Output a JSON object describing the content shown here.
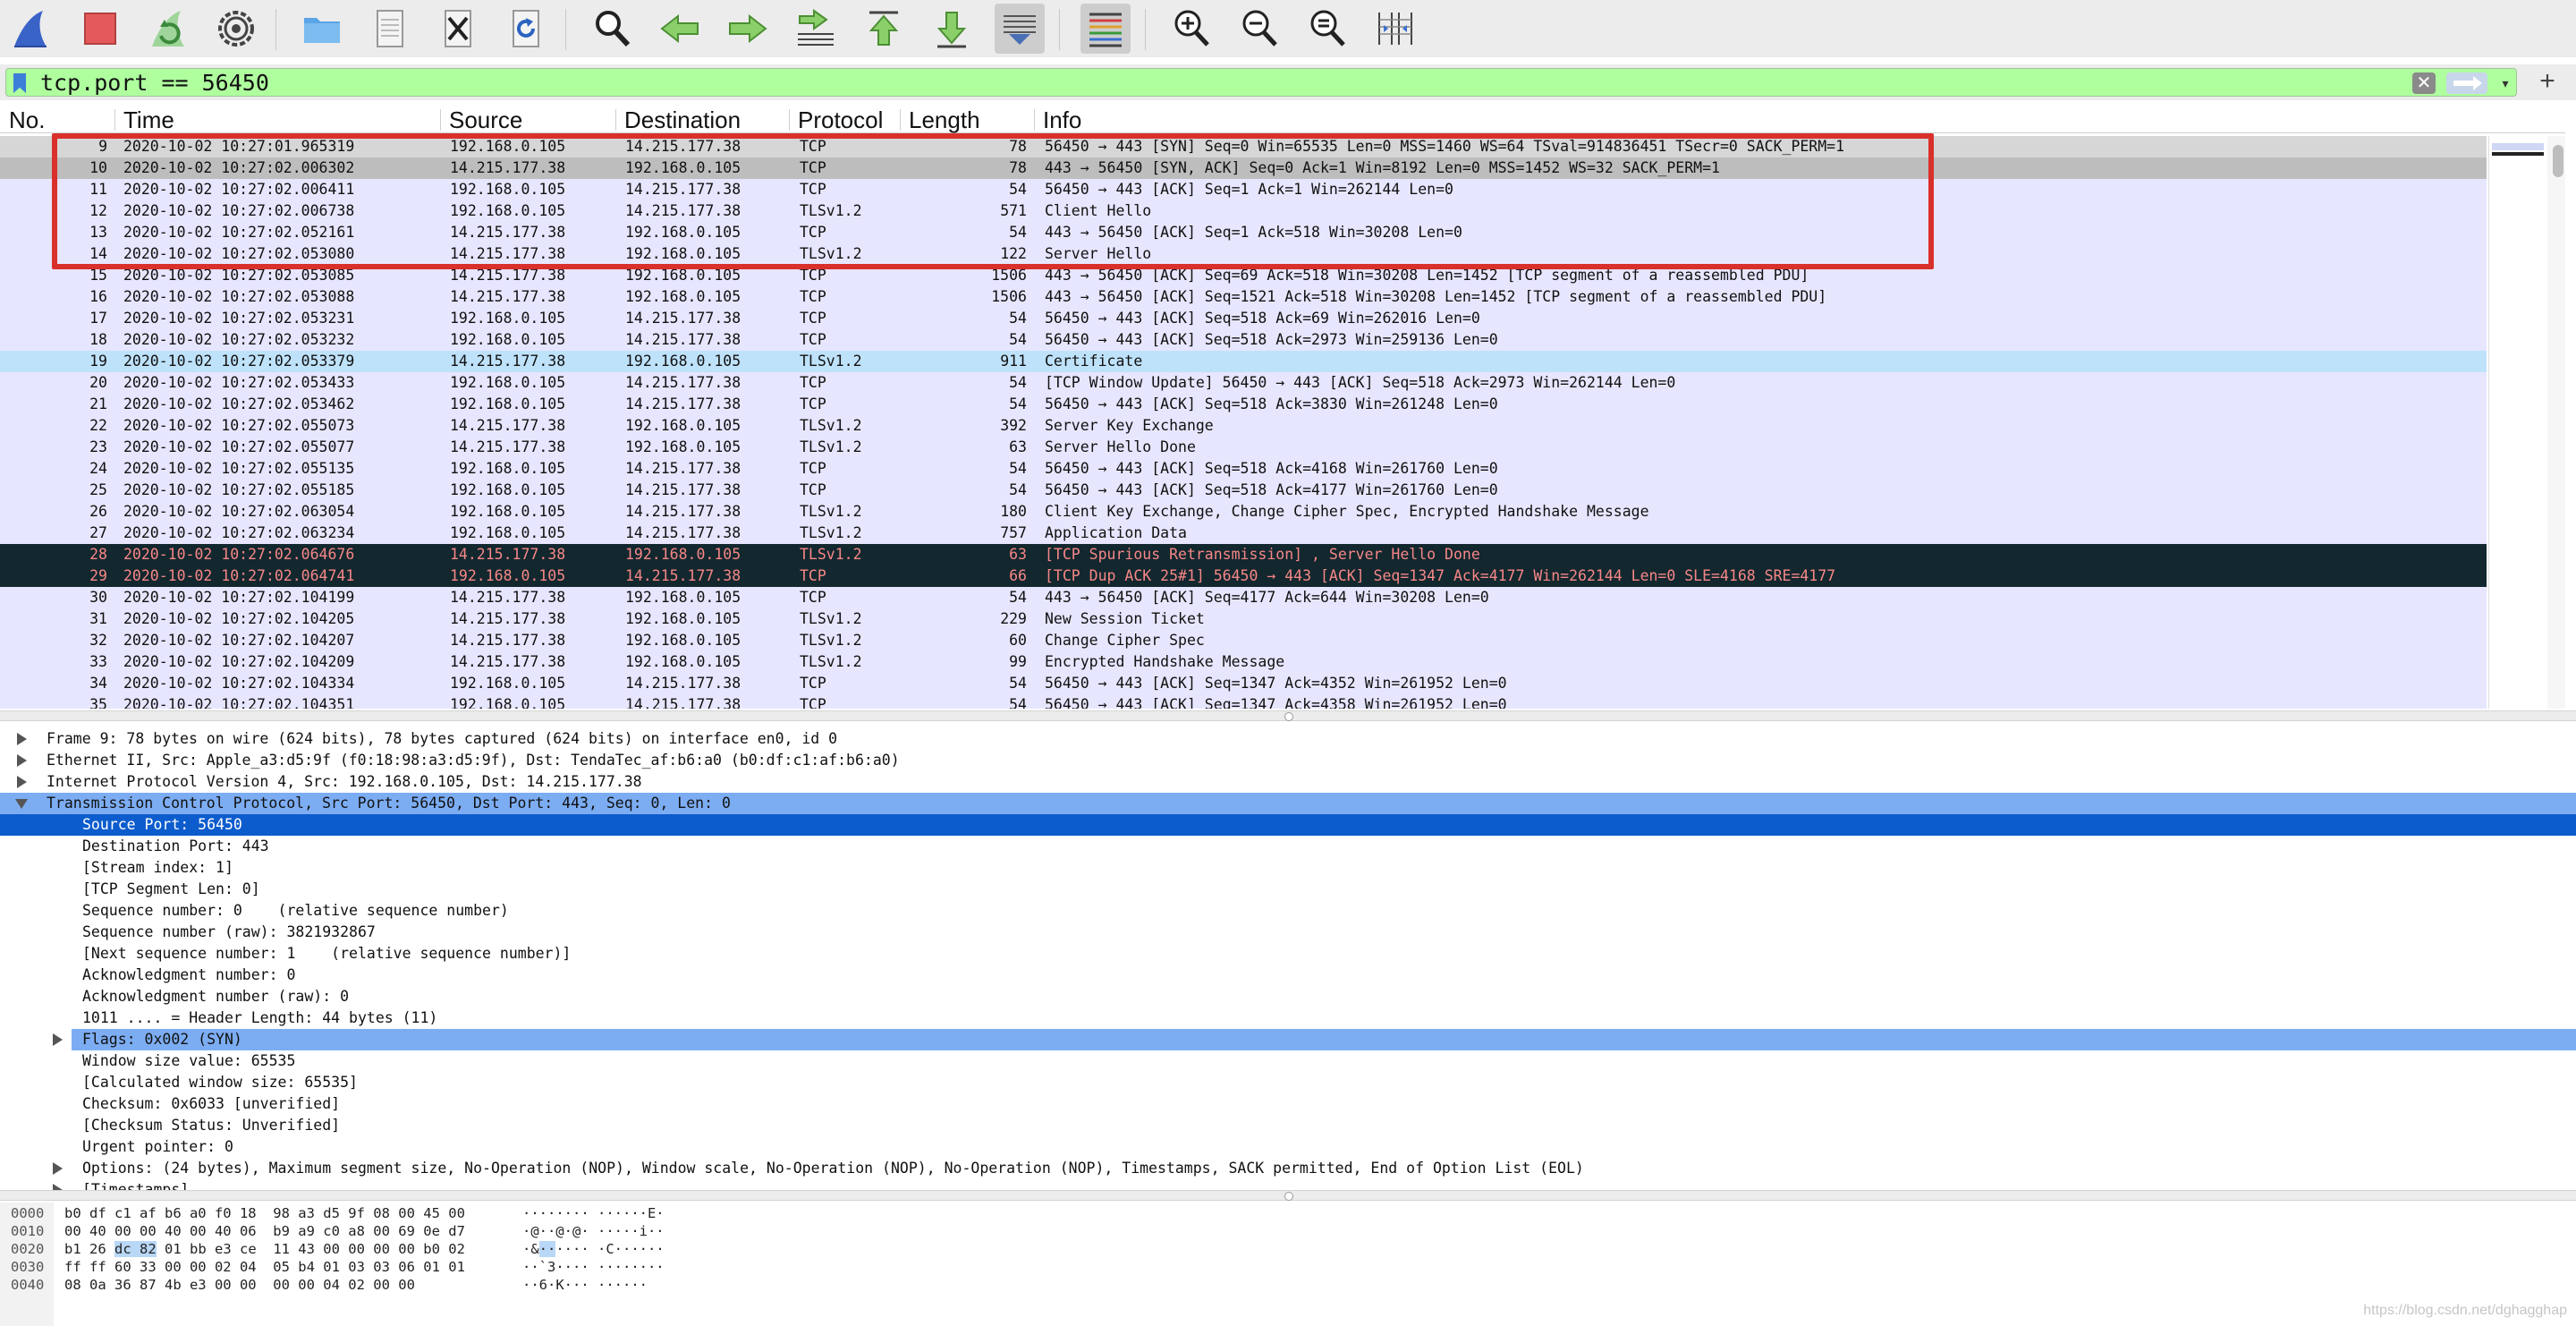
{
  "colors": {
    "row_tcp": "#e7e6ff",
    "row_selected": "#bdbdbd",
    "row_first": "#d6d6d6",
    "row_highlight": "#bfe2fb",
    "row_error_bg": "#12272e",
    "row_error_fg": "#f78787",
    "filter_bg": "#afff9f",
    "detail_selected": "#0d5ccd",
    "detail_header_selected": "#7cadf3",
    "annotation": "#d9302b"
  },
  "toolbar": {
    "icons": [
      "shark-fin-start-icon",
      "stop-capture-icon",
      "restart-capture-icon",
      "capture-options-gear-icon",
      "open-file-folder-icon",
      "file-document-icon",
      "close-file-icon",
      "reload-file-icon",
      "find-packet-magnifier-icon",
      "go-back-arrow-icon",
      "go-forward-arrow-icon",
      "go-to-packet-icon",
      "go-to-first-packet-icon",
      "go-to-last-packet-icon",
      "auto-scroll-icon",
      "colorize-icon",
      "zoom-in-icon",
      "zoom-out-icon",
      "normal-size-icon",
      "resize-columns-icon"
    ]
  },
  "filter": {
    "value": "tcp.port == 56450",
    "clear_glyph": "✕",
    "dropdown_glyph": "▾",
    "add_glyph": "+"
  },
  "columns": {
    "no": "No.",
    "time": "Time",
    "source": "Source",
    "destination": "Destination",
    "protocol": "Protocol",
    "length": "Length",
    "info": "Info"
  },
  "packets": [
    {
      "no": "9",
      "time": "2020-10-02 10:27:01.965319",
      "src": "192.168.0.105",
      "dst": "14.215.177.38",
      "proto": "TCP",
      "len": "78",
      "info": "56450 → 443 [SYN] Seq=0 Win=65535 Len=0 MSS=1460 WS=64 TSval=914836451 TSecr=0 SACK_PERM=1",
      "style": "first"
    },
    {
      "no": "10",
      "time": "2020-10-02 10:27:02.006302",
      "src": "14.215.177.38",
      "dst": "192.168.0.105",
      "proto": "TCP",
      "len": "78",
      "info": "443 → 56450 [SYN, ACK] Seq=0 Ack=1 Win=8192 Len=0 MSS=1452 WS=32 SACK_PERM=1",
      "style": "selected"
    },
    {
      "no": "11",
      "time": "2020-10-02 10:27:02.006411",
      "src": "192.168.0.105",
      "dst": "14.215.177.38",
      "proto": "TCP",
      "len": "54",
      "info": "56450 → 443 [ACK] Seq=1 Ack=1 Win=262144 Len=0",
      "style": "tcp"
    },
    {
      "no": "12",
      "time": "2020-10-02 10:27:02.006738",
      "src": "192.168.0.105",
      "dst": "14.215.177.38",
      "proto": "TLSv1.2",
      "len": "571",
      "info": "Client Hello",
      "style": "tcp"
    },
    {
      "no": "13",
      "time": "2020-10-02 10:27:02.052161",
      "src": "14.215.177.38",
      "dst": "192.168.0.105",
      "proto": "TCP",
      "len": "54",
      "info": "443 → 56450 [ACK] Seq=1 Ack=518 Win=30208 Len=0",
      "style": "tcp"
    },
    {
      "no": "14",
      "time": "2020-10-02 10:27:02.053080",
      "src": "14.215.177.38",
      "dst": "192.168.0.105",
      "proto": "TLSv1.2",
      "len": "122",
      "info": "Server Hello",
      "style": "tcp"
    },
    {
      "no": "15",
      "time": "2020-10-02 10:27:02.053085",
      "src": "14.215.177.38",
      "dst": "192.168.0.105",
      "proto": "TCP",
      "len": "1506",
      "info": "443 → 56450 [ACK] Seq=69 Ack=518 Win=30208 Len=1452 [TCP segment of a reassembled PDU]",
      "style": "tcp"
    },
    {
      "no": "16",
      "time": "2020-10-02 10:27:02.053088",
      "src": "14.215.177.38",
      "dst": "192.168.0.105",
      "proto": "TCP",
      "len": "1506",
      "info": "443 → 56450 [ACK] Seq=1521 Ack=518 Win=30208 Len=1452 [TCP segment of a reassembled PDU]",
      "style": "tcp"
    },
    {
      "no": "17",
      "time": "2020-10-02 10:27:02.053231",
      "src": "192.168.0.105",
      "dst": "14.215.177.38",
      "proto": "TCP",
      "len": "54",
      "info": "56450 → 443 [ACK] Seq=518 Ack=69 Win=262016 Len=0",
      "style": "tcp"
    },
    {
      "no": "18",
      "time": "2020-10-02 10:27:02.053232",
      "src": "192.168.0.105",
      "dst": "14.215.177.38",
      "proto": "TCP",
      "len": "54",
      "info": "56450 → 443 [ACK] Seq=518 Ack=2973 Win=259136 Len=0",
      "style": "tcp"
    },
    {
      "no": "19",
      "time": "2020-10-02 10:27:02.053379",
      "src": "14.215.177.38",
      "dst": "192.168.0.105",
      "proto": "TLSv1.2",
      "len": "911",
      "info": "Certificate",
      "style": "highlight"
    },
    {
      "no": "20",
      "time": "2020-10-02 10:27:02.053433",
      "src": "192.168.0.105",
      "dst": "14.215.177.38",
      "proto": "TCP",
      "len": "54",
      "info": "[TCP Window Update] 56450 → 443 [ACK] Seq=518 Ack=2973 Win=262144 Len=0",
      "style": "tcp"
    },
    {
      "no": "21",
      "time": "2020-10-02 10:27:02.053462",
      "src": "192.168.0.105",
      "dst": "14.215.177.38",
      "proto": "TCP",
      "len": "54",
      "info": "56450 → 443 [ACK] Seq=518 Ack=3830 Win=261248 Len=0",
      "style": "tcp"
    },
    {
      "no": "22",
      "time": "2020-10-02 10:27:02.055073",
      "src": "14.215.177.38",
      "dst": "192.168.0.105",
      "proto": "TLSv1.2",
      "len": "392",
      "info": "Server Key Exchange",
      "style": "tcp"
    },
    {
      "no": "23",
      "time": "2020-10-02 10:27:02.055077",
      "src": "14.215.177.38",
      "dst": "192.168.0.105",
      "proto": "TLSv1.2",
      "len": "63",
      "info": "Server Hello Done",
      "style": "tcp"
    },
    {
      "no": "24",
      "time": "2020-10-02 10:27:02.055135",
      "src": "192.168.0.105",
      "dst": "14.215.177.38",
      "proto": "TCP",
      "len": "54",
      "info": "56450 → 443 [ACK] Seq=518 Ack=4168 Win=261760 Len=0",
      "style": "tcp"
    },
    {
      "no": "25",
      "time": "2020-10-02 10:27:02.055185",
      "src": "192.168.0.105",
      "dst": "14.215.177.38",
      "proto": "TCP",
      "len": "54",
      "info": "56450 → 443 [ACK] Seq=518 Ack=4177 Win=261760 Len=0",
      "style": "tcp"
    },
    {
      "no": "26",
      "time": "2020-10-02 10:27:02.063054",
      "src": "192.168.0.105",
      "dst": "14.215.177.38",
      "proto": "TLSv1.2",
      "len": "180",
      "info": "Client Key Exchange, Change Cipher Spec, Encrypted Handshake Message",
      "style": "tcp"
    },
    {
      "no": "27",
      "time": "2020-10-02 10:27:02.063234",
      "src": "192.168.0.105",
      "dst": "14.215.177.38",
      "proto": "TLSv1.2",
      "len": "757",
      "info": "Application Data",
      "style": "tcp"
    },
    {
      "no": "28",
      "time": "2020-10-02 10:27:02.064676",
      "src": "14.215.177.38",
      "dst": "192.168.0.105",
      "proto": "TLSv1.2",
      "len": "63",
      "info": "[TCP Spurious Retransmission] , Server Hello Done",
      "style": "error"
    },
    {
      "no": "29",
      "time": "2020-10-02 10:27:02.064741",
      "src": "192.168.0.105",
      "dst": "14.215.177.38",
      "proto": "TCP",
      "len": "66",
      "info": "[TCP Dup ACK 25#1] 56450 → 443 [ACK] Seq=1347 Ack=4177 Win=262144 Len=0 SLE=4168 SRE=4177",
      "style": "error"
    },
    {
      "no": "30",
      "time": "2020-10-02 10:27:02.104199",
      "src": "14.215.177.38",
      "dst": "192.168.0.105",
      "proto": "TCP",
      "len": "54",
      "info": "443 → 56450 [ACK] Seq=4177 Ack=644 Win=30208 Len=0",
      "style": "tcp"
    },
    {
      "no": "31",
      "time": "2020-10-02 10:27:02.104205",
      "src": "14.215.177.38",
      "dst": "192.168.0.105",
      "proto": "TLSv1.2",
      "len": "229",
      "info": "New Session Ticket",
      "style": "tcp"
    },
    {
      "no": "32",
      "time": "2020-10-02 10:27:02.104207",
      "src": "14.215.177.38",
      "dst": "192.168.0.105",
      "proto": "TLSv1.2",
      "len": "60",
      "info": "Change Cipher Spec",
      "style": "tcp"
    },
    {
      "no": "33",
      "time": "2020-10-02 10:27:02.104209",
      "src": "14.215.177.38",
      "dst": "192.168.0.105",
      "proto": "TLSv1.2",
      "len": "99",
      "info": "Encrypted Handshake Message",
      "style": "tcp"
    },
    {
      "no": "34",
      "time": "2020-10-02 10:27:02.104334",
      "src": "192.168.0.105",
      "dst": "14.215.177.38",
      "proto": "TCP",
      "len": "54",
      "info": "56450 → 443 [ACK] Seq=1347 Ack=4352 Win=261952 Len=0",
      "style": "tcp"
    },
    {
      "no": "35",
      "time": "2020-10-02 10:27:02.104351",
      "src": "192.168.0.105",
      "dst": "14.215.177.38",
      "proto": "TCP",
      "len": "54",
      "info": "56450 → 443 [ACK] Seq=1347 Ack=4358 Win=261952 Len=0",
      "style": "tcp"
    }
  ],
  "details": [
    {
      "text": "Frame 9: 78 bytes on wire (624 bits), 78 bytes captured (624 bits) on interface en0, id 0",
      "level": 0,
      "toggle": "collapsed",
      "style": ""
    },
    {
      "text": "Ethernet II, Src: Apple_a3:d5:9f (f0:18:98:a3:d5:9f), Dst: TendaTec_af:b6:a0 (b0:df:c1:af:b6:a0)",
      "level": 0,
      "toggle": "collapsed",
      "style": ""
    },
    {
      "text": "Internet Protocol Version 4, Src: 192.168.0.105, Dst: 14.215.177.38",
      "level": 0,
      "toggle": "collapsed",
      "style": ""
    },
    {
      "text": "Transmission Control Protocol, Src Port: 56450, Dst Port: 443, Seq: 0, Len: 0",
      "level": 0,
      "toggle": "expanded",
      "style": "header-selected"
    },
    {
      "text": "Source Port: 56450",
      "level": 1,
      "toggle": "",
      "style": "selected"
    },
    {
      "text": "Destination Port: 443",
      "level": 1,
      "toggle": "",
      "style": ""
    },
    {
      "text": "[Stream index: 1]",
      "level": 1,
      "toggle": "",
      "style": ""
    },
    {
      "text": "[TCP Segment Len: 0]",
      "level": 1,
      "toggle": "",
      "style": ""
    },
    {
      "text": "Sequence number: 0    (relative sequence number)",
      "level": 1,
      "toggle": "",
      "style": ""
    },
    {
      "text": "Sequence number (raw): 3821932867",
      "level": 1,
      "toggle": "",
      "style": ""
    },
    {
      "text": "[Next sequence number: 1    (relative sequence number)]",
      "level": 1,
      "toggle": "",
      "style": ""
    },
    {
      "text": "Acknowledgment number: 0",
      "level": 1,
      "toggle": "",
      "style": ""
    },
    {
      "text": "Acknowledgment number (raw): 0",
      "level": 1,
      "toggle": "",
      "style": ""
    },
    {
      "text": "1011 .... = Header Length: 44 bytes (11)",
      "level": 1,
      "toggle": "",
      "style": ""
    },
    {
      "text": "Flags: 0x002 (SYN)",
      "level": 1,
      "toggle": "collapsed",
      "style": "header-selected"
    },
    {
      "text": "Window size value: 65535",
      "level": 1,
      "toggle": "",
      "style": ""
    },
    {
      "text": "[Calculated window size: 65535]",
      "level": 1,
      "toggle": "",
      "style": ""
    },
    {
      "text": "Checksum: 0x6033 [unverified]",
      "level": 1,
      "toggle": "",
      "style": ""
    },
    {
      "text": "[Checksum Status: Unverified]",
      "level": 1,
      "toggle": "",
      "style": ""
    },
    {
      "text": "Urgent pointer: 0",
      "level": 1,
      "toggle": "",
      "style": ""
    },
    {
      "text": "Options: (24 bytes), Maximum segment size, No-Operation (NOP), Window scale, No-Operation (NOP), No-Operation (NOP), Timestamps, SACK permitted, End of Option List (EOL)",
      "level": 1,
      "toggle": "collapsed",
      "style": ""
    },
    {
      "text": "[Timestamps]",
      "level": 1,
      "toggle": "collapsed",
      "style": ""
    }
  ],
  "bytes": [
    {
      "offset": "0000",
      "hex": "b0 df c1 af b6 a0 f0 18  98 a3 d5 9f 08 00 45 00",
      "ascii": "········ ······E·"
    },
    {
      "offset": "0010",
      "hex": "00 40 00 00 40 00 40 06  b9 a9 c0 a8 00 69 0e d7",
      "ascii": "·@··@·@· ·····i··"
    },
    {
      "offset": "0020",
      "hex_pre": "b1 26 ",
      "hex_hl": "dc 82",
      "hex_post": " 01 bb e3 ce  11 43 00 00 00 00 b0 02",
      "ascii_pre": "·&",
      "ascii_hl": "··",
      "ascii_post": "···· ·C······"
    },
    {
      "offset": "0030",
      "hex": "ff ff 60 33 00 00 02 04  05 b4 01 03 03 06 01 01",
      "ascii": "··`3···· ········"
    },
    {
      "offset": "0040",
      "hex": "08 0a 36 87 4b e3 00 00  00 00 04 02 00 00",
      "ascii": "··6·K··· ······"
    }
  ],
  "watermark": "https://blog.csdn.net/dghagghap"
}
